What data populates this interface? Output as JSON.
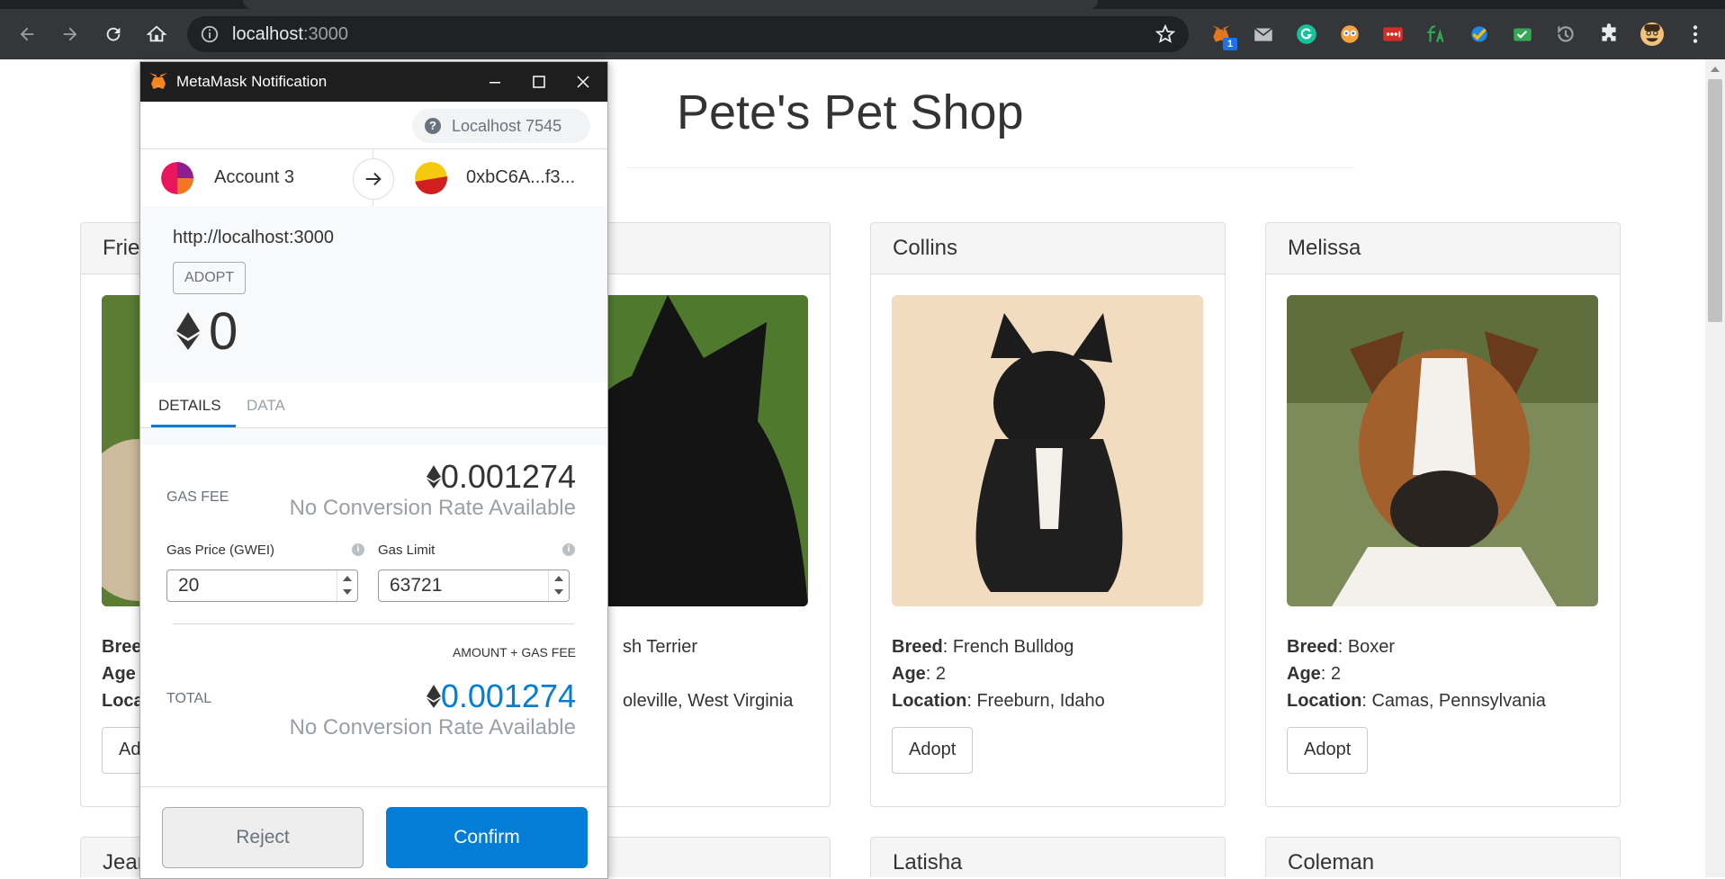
{
  "browser": {
    "url_host": "localhost",
    "url_port": ":3000",
    "extension_badge": "1"
  },
  "page": {
    "title": "Pete's Pet Shop",
    "adopt_label": "Adopt",
    "breed_label": "Breed",
    "age_label": "Age",
    "location_label": "Location",
    "pets": [
      {
        "name": "Frie",
        "breed": "",
        "age": "",
        "location": ""
      },
      {
        "name": "",
        "breed": "sh Terrier",
        "age": "",
        "location": "oleville, West Virginia"
      },
      {
        "name": "Collins",
        "breed": "French Bulldog",
        "age": "2",
        "location": "Freeburn, Idaho"
      },
      {
        "name": "Melissa",
        "breed": "Boxer",
        "age": "2",
        "location": "Camas, Pennsylvania"
      }
    ],
    "bottom_row": [
      "Jean",
      "Latisha",
      "Coleman"
    ],
    "partial_labels": {
      "breed": "Bree",
      "age": "Age",
      "location": "Loca",
      "adopt": "Ad"
    }
  },
  "metamask": {
    "window_title": "MetaMask Notification",
    "network": "Localhost 7545",
    "from_account": "Account 3",
    "to_address": "0xbC6A...f3...",
    "origin": "http://localhost:3000",
    "method": "ADOPT",
    "amount": "0",
    "tabs": [
      "DETAILS",
      "DATA"
    ],
    "gas_fee_label": "GAS FEE",
    "gas_fee": "0.001274",
    "no_conversion": "No Conversion Rate Available",
    "gas_price_label": "Gas Price (GWEI)",
    "gas_limit_label": "Gas Limit",
    "gas_price_value": "20",
    "gas_limit_value": "63721",
    "amount_gas_label": "AMOUNT + GAS FEE",
    "total_label": "TOTAL",
    "total": "0.001274",
    "reject": "Reject",
    "confirm": "Confirm",
    "accent": "#037dd6"
  }
}
